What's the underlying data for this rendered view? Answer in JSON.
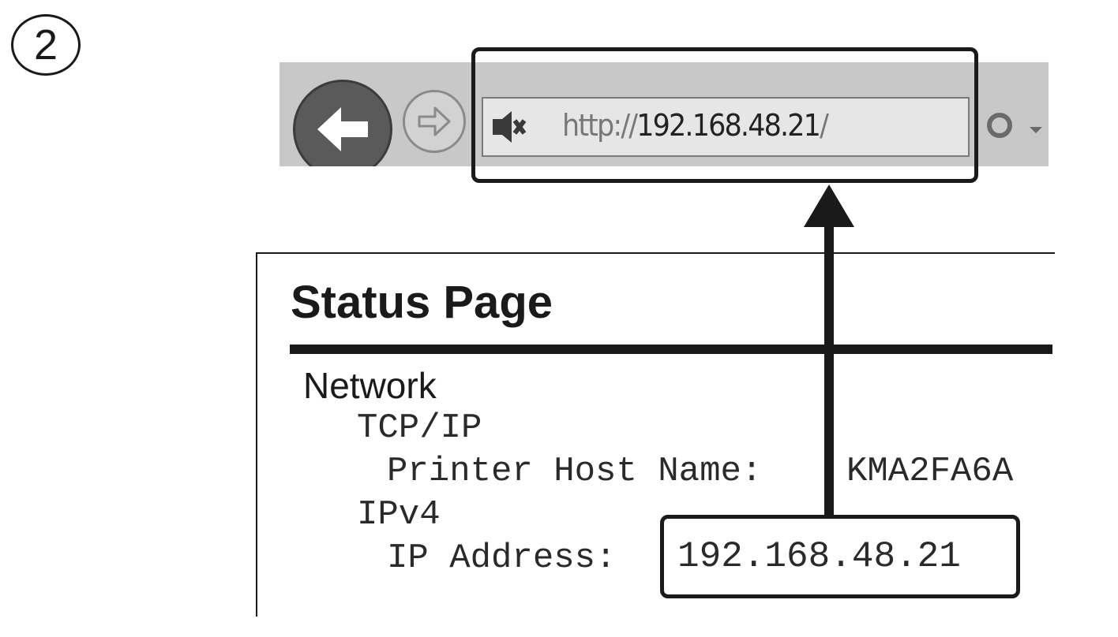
{
  "step": {
    "number": "2"
  },
  "browser": {
    "back_icon": "back-arrow-icon",
    "forward_icon": "forward-arrow-icon",
    "page_icon": "page-compatibility-icon",
    "search_icon": "search-icon",
    "url_protocol": "http://",
    "url_host": "192.168.48.21",
    "url_trailing": "/"
  },
  "status_page": {
    "title": "Status Page",
    "section": "Network",
    "tcpip_label": "TCP/IP",
    "host_name_label": "Printer Host Name:",
    "host_name_value": "KMA2FA6A",
    "ipv4_label": "IPv4",
    "ip_address_label": "IP Address:",
    "ip_address_value": "192.168.48.21"
  },
  "colors": {
    "outline": "#1a1a1a",
    "toolbar": "#c8c8c8",
    "address_bar": "#e6e6e6"
  }
}
